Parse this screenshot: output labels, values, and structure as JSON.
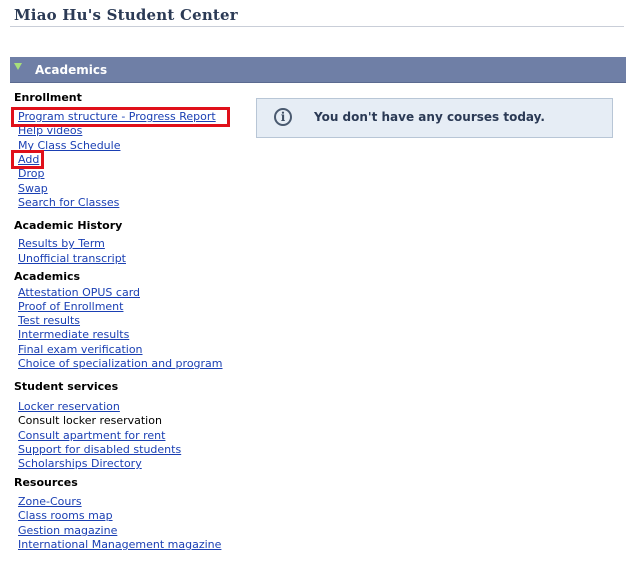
{
  "page_title": "Miao Hu's Student Center",
  "section": {
    "title": "Academics"
  },
  "groups": [
    {
      "title": "Enrollment",
      "items": [
        "Program structure - Progress Report",
        "Help videos",
        "My Class Schedule",
        "Add",
        "Drop",
        "Swap",
        "Search for Classes"
      ]
    },
    {
      "title": "Academic History",
      "items": [
        "Results by Term",
        "Unofficial transcript"
      ]
    },
    {
      "title": "Academics",
      "items": [
        "Attestation OPUS card",
        "Proof of Enrollment",
        "Test results",
        "Intermediate results",
        "Final exam verification",
        "Choice of specialization and program"
      ]
    },
    {
      "title": "Student services",
      "items": [
        "Locker reservation",
        "Consult locker reservation",
        "Consult apartment for rent",
        "Support for disabled students",
        "Scholarships Directory"
      ]
    },
    {
      "title": "Resources",
      "items": [
        "Zone-Cours",
        "Class rooms map",
        "Gestion magazine",
        "International Management magazine"
      ]
    }
  ],
  "notice": {
    "icon": "info-icon",
    "text": "You don't have any courses today."
  },
  "colors": {
    "header_bg": "#6f7fa6",
    "link": "#1a3fb3",
    "highlight": "#e0101a",
    "notice_bg": "#e6edf5"
  }
}
